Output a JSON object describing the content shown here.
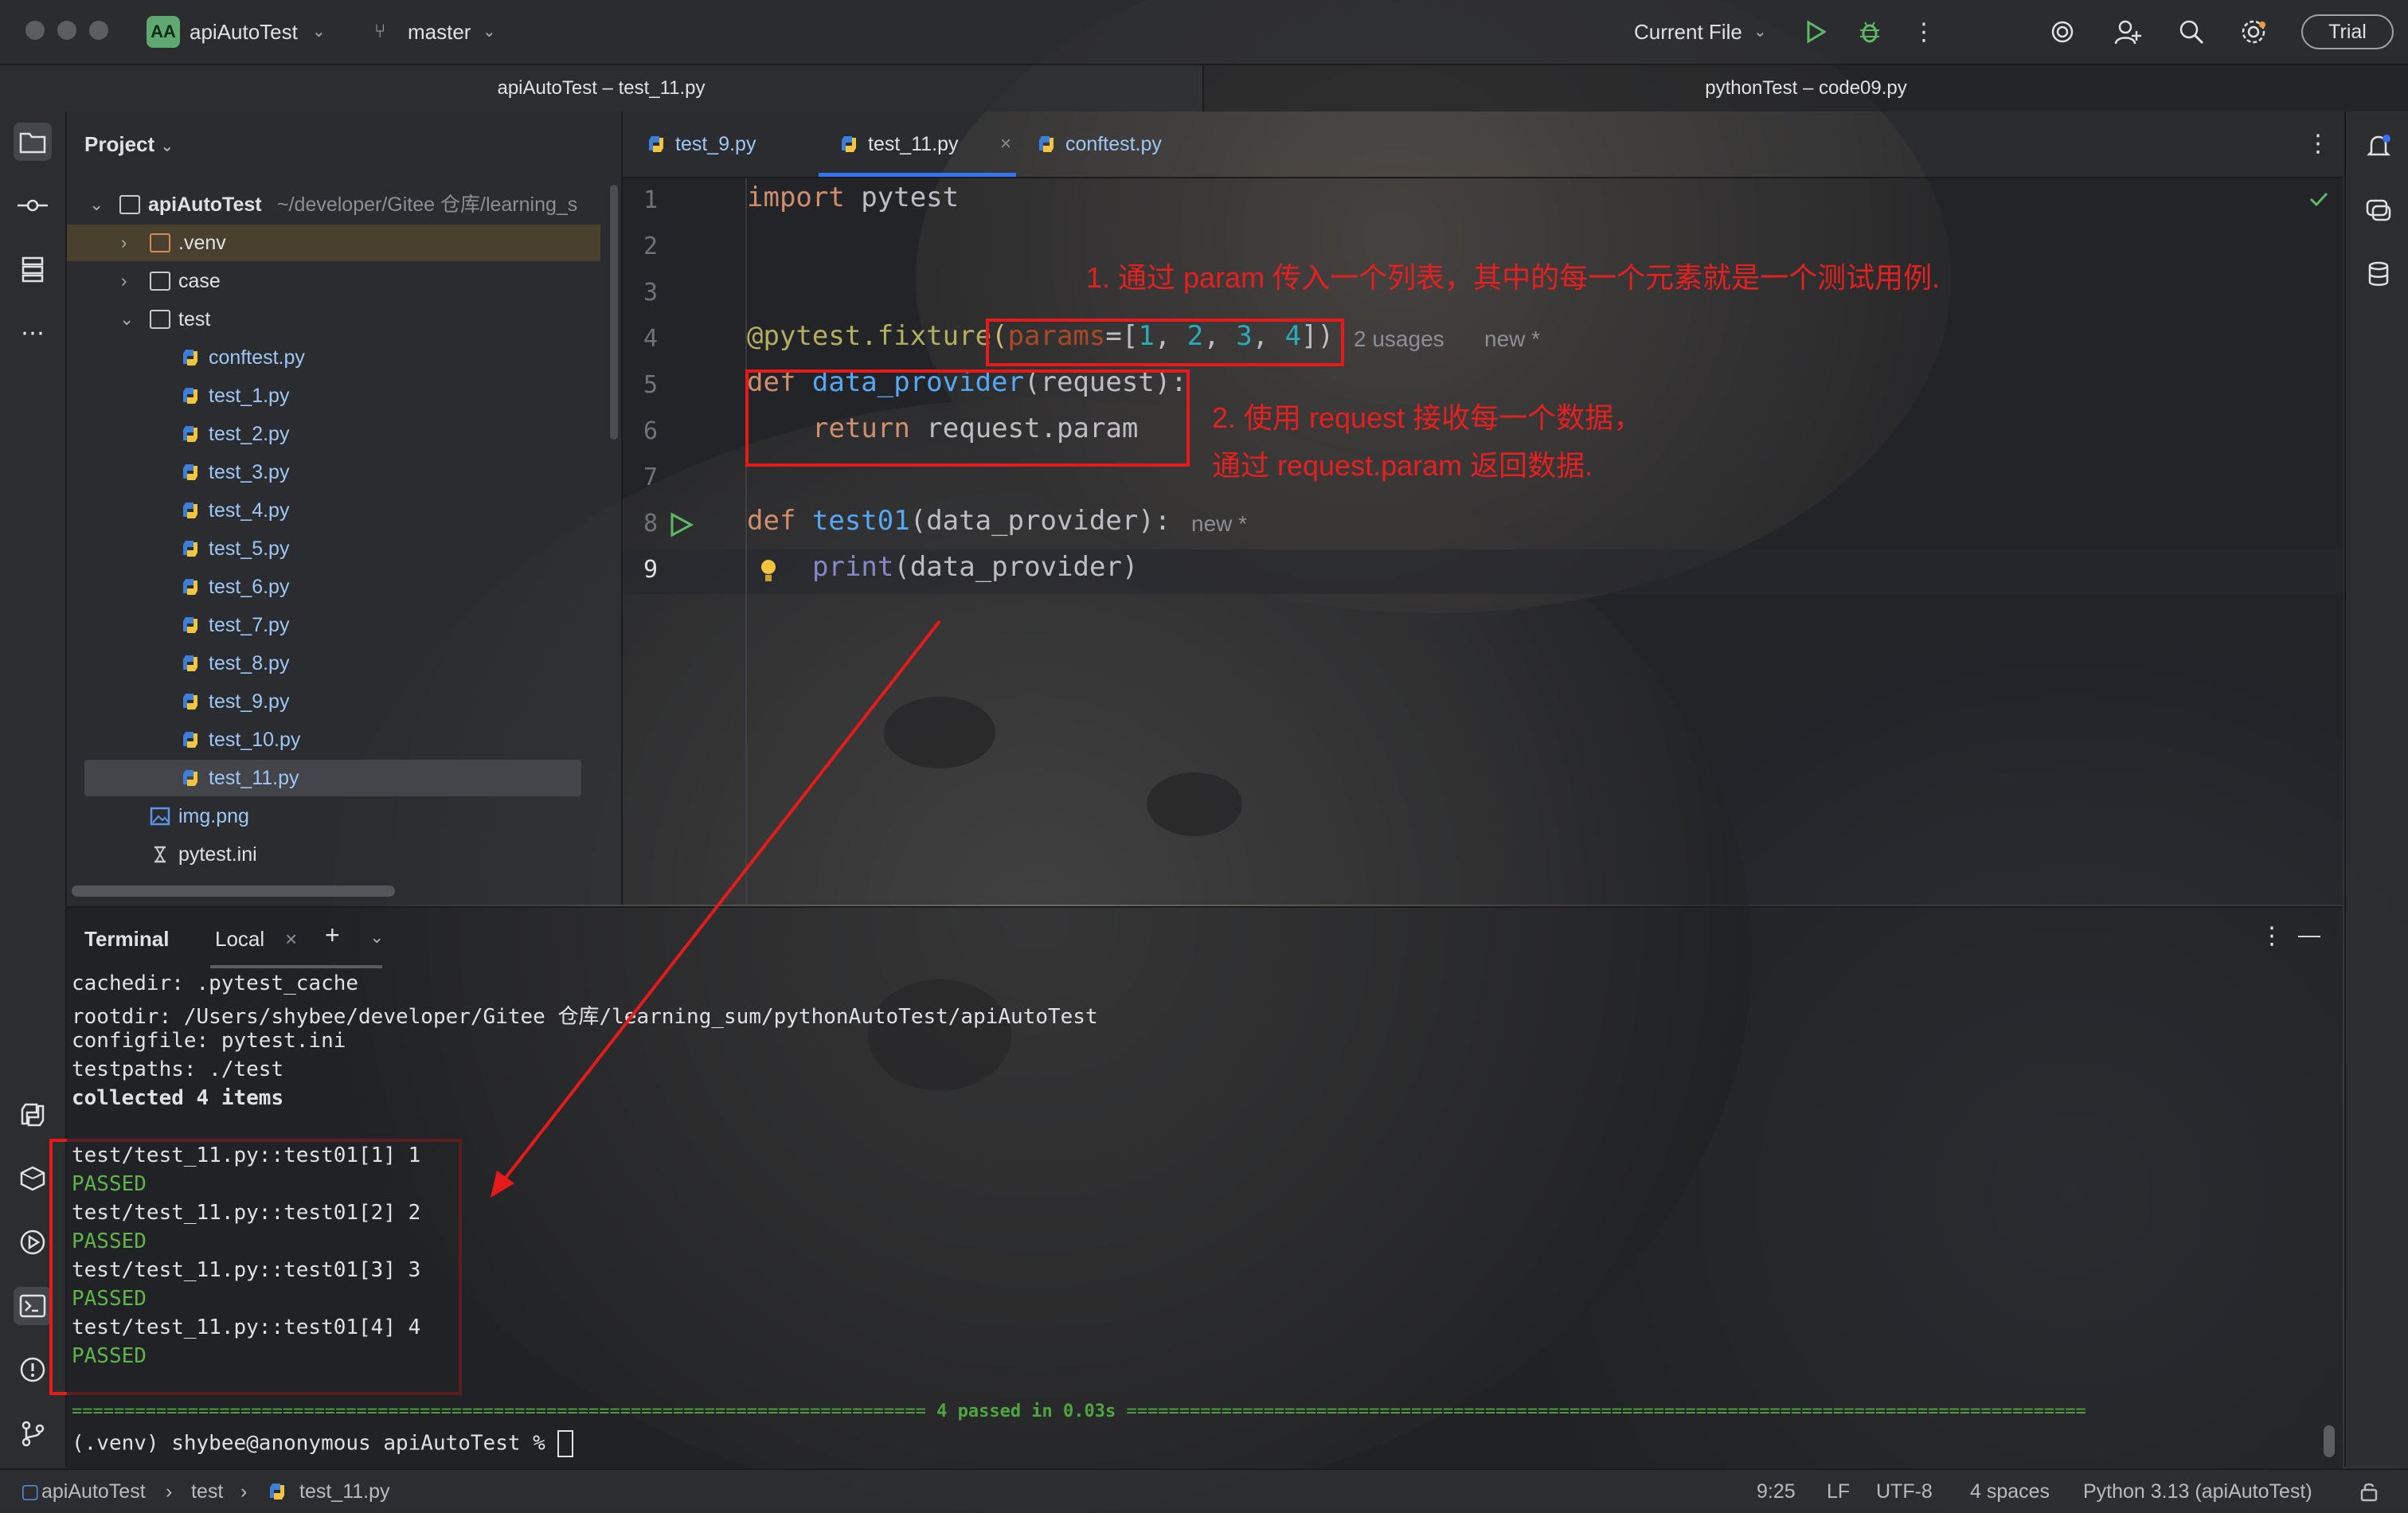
{
  "titlebar": {
    "project_badge": "AA",
    "project_name": "apiAutoTest",
    "branch": "master",
    "run_config": "Current File",
    "trial_label": "Trial"
  },
  "window_tabs": [
    "apiAutoTest – test_11.py",
    "pythonTest – code09.py"
  ],
  "project_panel": {
    "title": "Project",
    "root_name": "apiAutoTest",
    "root_path": "~/developer/Gitee 仓库/learning_s",
    "items": [
      {
        "label": ".venv",
        "type": "folder-excluded"
      },
      {
        "label": "case",
        "type": "folder"
      },
      {
        "label": "test",
        "type": "folder"
      },
      {
        "label": "conftest.py",
        "type": "py"
      },
      {
        "label": "test_1.py",
        "type": "py"
      },
      {
        "label": "test_2.py",
        "type": "py"
      },
      {
        "label": "test_3.py",
        "type": "py"
      },
      {
        "label": "test_4.py",
        "type": "py"
      },
      {
        "label": "test_5.py",
        "type": "py"
      },
      {
        "label": "test_6.py",
        "type": "py"
      },
      {
        "label": "test_7.py",
        "type": "py"
      },
      {
        "label": "test_8.py",
        "type": "py"
      },
      {
        "label": "test_9.py",
        "type": "py"
      },
      {
        "label": "test_10.py",
        "type": "py"
      },
      {
        "label": "test_11.py",
        "type": "py"
      },
      {
        "label": "img.png",
        "type": "image"
      },
      {
        "label": "pytest.ini",
        "type": "ini"
      }
    ]
  },
  "editor_tabs": [
    {
      "label": "test_9.py",
      "active": false
    },
    {
      "label": "test_11.py",
      "active": true
    },
    {
      "label": "conftest.py",
      "active": false
    }
  ],
  "editor": {
    "line_numbers": [
      "1",
      "2",
      "3",
      "4",
      "5",
      "6",
      "7",
      "8",
      "9"
    ],
    "line1": {
      "kw": "import",
      "rest": " pytest"
    },
    "line4": {
      "dec": "@pytest.fixture",
      "open": "(",
      "param": "params",
      "eq": "=[",
      "n1": "1",
      "c1": ", ",
      "n2": "2",
      "c2": ", ",
      "n3": "3",
      "c3": ", ",
      "n4": "4",
      "close": "])"
    },
    "line4_hint_usages": "2 usages",
    "line4_hint_new": "new *",
    "line5": {
      "kw": "def",
      "fn": " data_provider",
      "rest": "(request):"
    },
    "line6": {
      "kw": "return",
      "rest": " request.param"
    },
    "line8": {
      "kw": "def",
      "fn": " test01",
      "rest": "(data_provider):"
    },
    "line8_hint_new": "new *",
    "line9": {
      "fn": "print",
      "rest": "(data_provider)"
    }
  },
  "annotations": {
    "note1": "1. 通过 param 传入一个列表，其中的每一个元素就是一个测试用例.",
    "note2_line1": "2. 使用 request 接收每一个数据，",
    "note2_line2": "通过 request.param 返回数据."
  },
  "terminal": {
    "title": "Terminal",
    "tab": "Local",
    "lines": [
      "cachedir: .pytest_cache",
      "rootdir: /Users/shybee/developer/Gitee 仓库/learning_sum/pythonAutoTest/apiAutoTest",
      "configfile: pytest.ini",
      "testpaths: ./test",
      "collected 4 items"
    ],
    "results": [
      {
        "test": "test/test_11.py::test01[1] 1",
        "status": "PASSED"
      },
      {
        "test": "test/test_11.py::test01[2] 2",
        "status": "PASSED"
      },
      {
        "test": "test/test_11.py::test01[3] 3",
        "status": "PASSED"
      },
      {
        "test": "test/test_11.py::test01[4] 4",
        "status": "PASSED"
      }
    ],
    "summary_left": "=================================================================================",
    "summary_text": " 4 passed in 0.03s ",
    "summary_right": "===========================================================================================",
    "prompt": "(.venv) shybee@anonymous apiAutoTest % "
  },
  "statusbar": {
    "breadcrumb": [
      "apiAutoTest",
      "test",
      "test_11.py"
    ],
    "position": "9:25",
    "line_ending": "LF",
    "encoding": "UTF-8",
    "indent": "4 spaces",
    "interpreter": "Python 3.13 (apiAutoTest)"
  }
}
